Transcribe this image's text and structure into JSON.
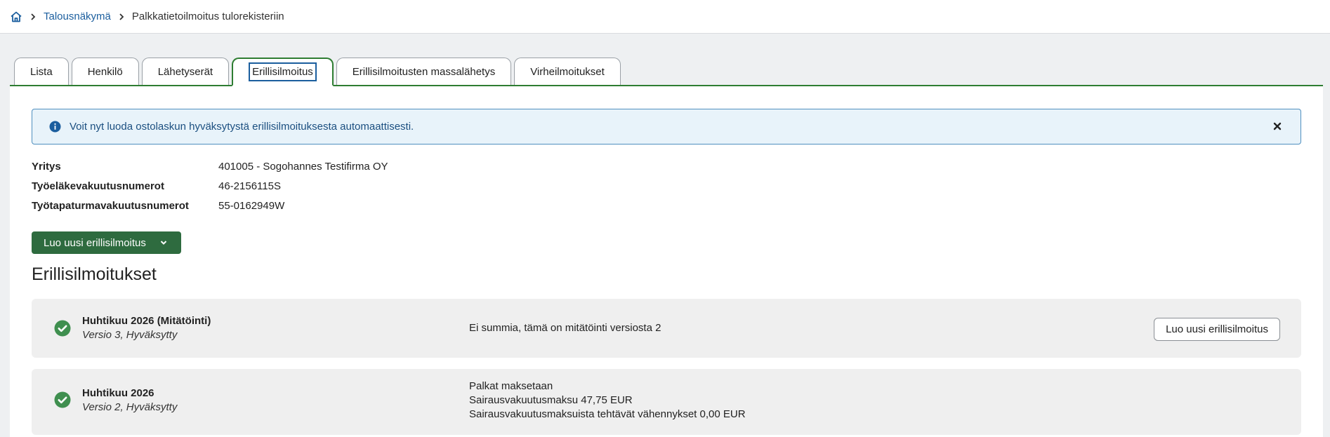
{
  "breadcrumb": {
    "home_icon": "home-icon",
    "link": "Talousnäkymä",
    "current": "Palkkatietoilmoitus tulorekisteriin"
  },
  "tabs": [
    {
      "label": "Lista",
      "active": false
    },
    {
      "label": "Henkilö",
      "active": false
    },
    {
      "label": "Lähetyserät",
      "active": false
    },
    {
      "label": "Erillisilmoitus",
      "active": true
    },
    {
      "label": "Erillisilmoitusten massalähetys",
      "active": false
    },
    {
      "label": "Virheilmoitukset",
      "active": false
    }
  ],
  "info": {
    "icon": "info-icon",
    "text": "Voit nyt luoda ostolaskun hyväksytystä erillisilmoituksesta automaattisesti."
  },
  "meta": [
    {
      "label": "Yritys",
      "value": "401005 - Sogohannes Testifirma OY"
    },
    {
      "label": "Työeläkevakuutusnumerot",
      "value": "46-2156115S"
    },
    {
      "label": "Työtapaturmavakuutusnumerot",
      "value": "55-0162949W"
    }
  ],
  "create_button": {
    "label": "Luo uusi erillisilmoitus"
  },
  "section_title": "Erillisilmoitukset",
  "cards": [
    {
      "title": "Huhtikuu 2026 (Mitätöinti)",
      "subtitle": "Versio 3, Hyväksytty",
      "lines": [
        "Ei summia, tämä on mitätöinti versiosta 2"
      ],
      "button": "Luo uusi erillisilmoitus"
    },
    {
      "title": "Huhtikuu 2026",
      "subtitle": "Versio 2, Hyväksytty",
      "lines": [
        "Palkat maksetaan",
        "Sairausvakuutusmaksu 47,75 EUR",
        "Sairausvakuutusmaksuista tehtävät vähennykset 0,00 EUR"
      ]
    }
  ],
  "colors": {
    "accent_green": "#2e7d32",
    "button_green": "#2e6b3f",
    "link_blue": "#1b5e9e",
    "info_bg": "#e8f3fa",
    "card_bg": "#efefef"
  }
}
